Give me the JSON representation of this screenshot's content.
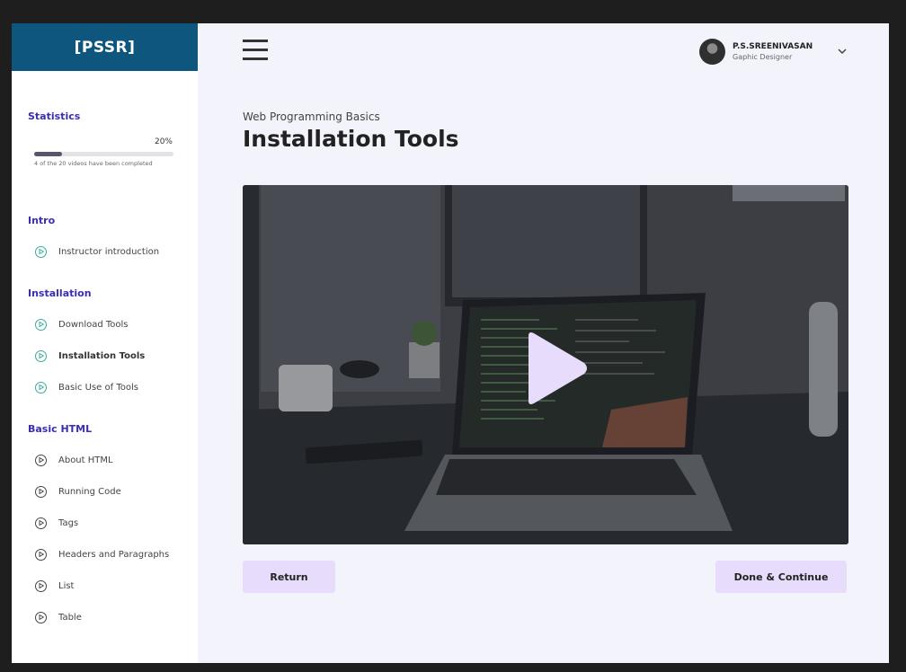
{
  "brand": {
    "logo_text": "[PSSR]"
  },
  "statistics": {
    "title": "Statistics",
    "percent_label": "20%",
    "progress_fraction": 0.2,
    "note": "4 of the 20 videos have been completed"
  },
  "sections": [
    {
      "title": "Intro",
      "items": [
        {
          "label": "Instructor introduction",
          "done": true
        }
      ]
    },
    {
      "title": "Installation",
      "items": [
        {
          "label": "Download Tools",
          "done": true
        },
        {
          "label": "Installation Tools",
          "done": true,
          "active": true
        },
        {
          "label": "Basic Use of Tools",
          "done": true
        }
      ]
    },
    {
      "title": "Basic HTML",
      "items": [
        {
          "label": "About HTML",
          "done": false
        },
        {
          "label": "Running Code",
          "done": false
        },
        {
          "label": "Tags",
          "done": false
        },
        {
          "label": "Headers and Paragraphs",
          "done": false
        },
        {
          "label": "List",
          "done": false
        },
        {
          "label": "Table",
          "done": false
        }
      ]
    }
  ],
  "header": {
    "menu_icon": "hamburger-menu-icon",
    "user_name": "P.S.SREENIVASAN",
    "user_role": "Gaphic Designer",
    "dropdown_icon": "chevron-down-icon"
  },
  "main": {
    "course_name": "Web Programming Basics",
    "page_title": "Installation Tools",
    "video_play_icon": "play-icon"
  },
  "buttons": {
    "return_label": "Return",
    "continue_label": "Done & Continue"
  },
  "colors": {
    "brand": "#0f567e",
    "section_title": "#3a2db5",
    "done_icon": "#3aa99e",
    "button_bg": "#e7dcfb",
    "play_icon": "#e8dcfc"
  }
}
